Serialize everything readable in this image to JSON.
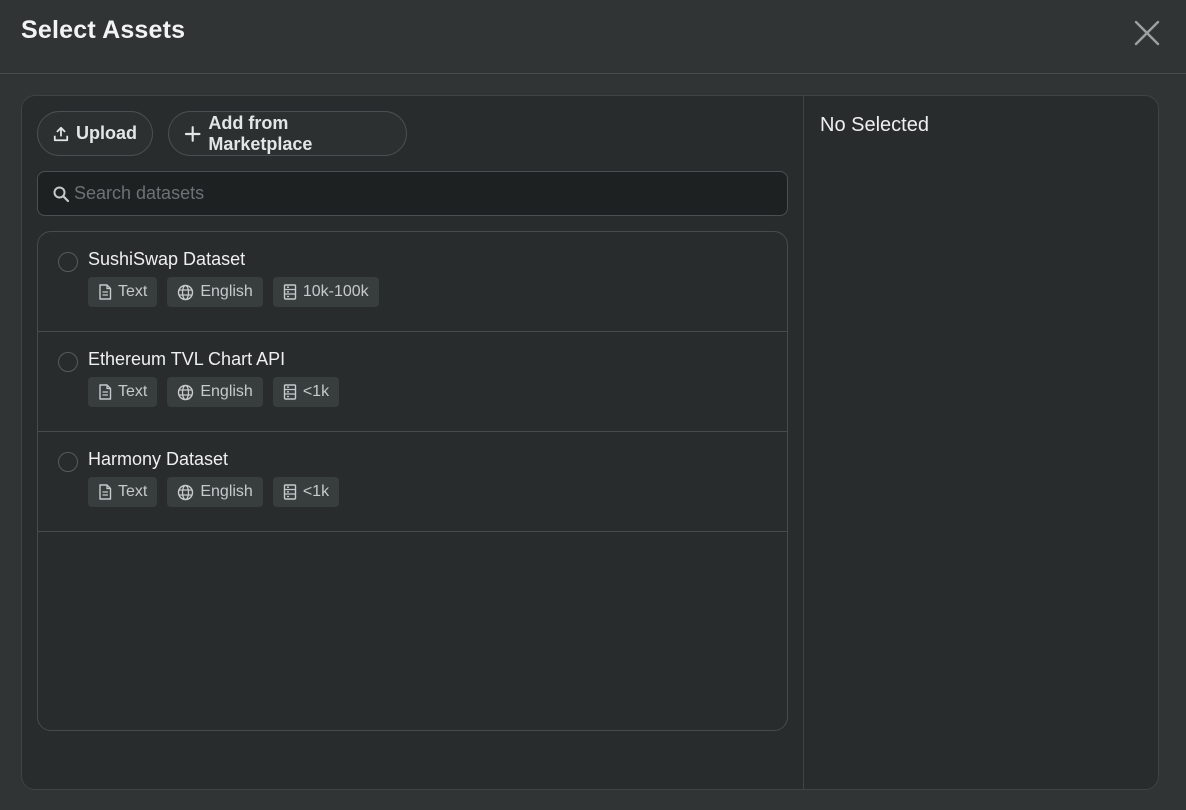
{
  "dialog": {
    "title": "Select Assets"
  },
  "toolbar": {
    "upload_label": "Upload",
    "add_marketplace_label": "Add from Marketplace"
  },
  "search": {
    "placeholder": "Search datasets",
    "value": ""
  },
  "selection": {
    "empty_label": "No Selected"
  },
  "datasets": [
    {
      "name": "SushiSwap Dataset",
      "tags": {
        "type": "Text",
        "language": "English",
        "size": "10k-100k"
      },
      "selected": false
    },
    {
      "name": "Ethereum TVL Chart API",
      "tags": {
        "type": "Text",
        "language": "English",
        "size": "<1k"
      },
      "selected": false
    },
    {
      "name": "Harmony Dataset",
      "tags": {
        "type": "Text",
        "language": "English",
        "size": "<1k"
      },
      "selected": false
    }
  ],
  "icons": {
    "close": "close-icon",
    "upload": "upload-icon",
    "add": "plus-icon",
    "search": "search-icon",
    "type": "document-icon",
    "language": "globe-icon",
    "size": "database-icon"
  },
  "colors": {
    "background": "#303435",
    "panel": "#292c2d",
    "border": "#464b4c",
    "tag_background": "#383d3e",
    "text_primary": "#eef0f0",
    "text_muted": "#c6cacb"
  }
}
